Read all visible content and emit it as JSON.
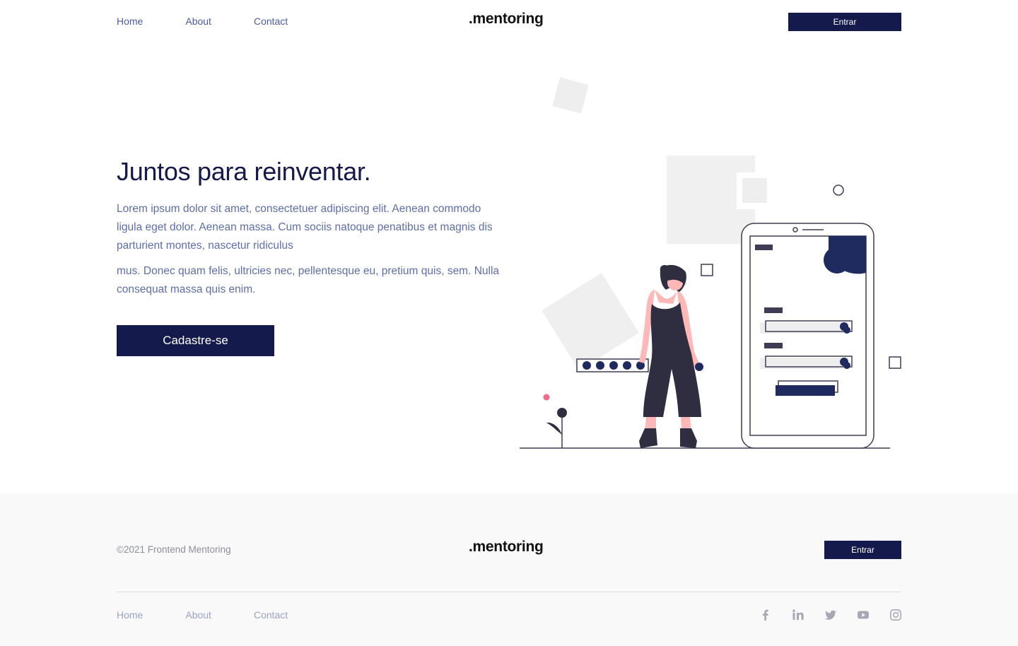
{
  "header": {
    "nav": [
      "Home",
      "About",
      "Contact"
    ],
    "logo": ".mentoring",
    "login_button": "Entrar"
  },
  "hero": {
    "title": "Juntos para reinventar.",
    "paragraph1": "Lorem ipsum dolor sit amet, consectetuer adipiscing elit. Aenean commodo ligula eget dolor. Aenean massa. Cum sociis natoque penatibus et magnis dis parturient montes, nascetur ridiculus",
    "paragraph2": "mus. Donec quam felis, ultricies nec, pellentesque eu, pretium quis, sem. Nulla consequat massa quis enim.",
    "cta_button": "Cadastre-se"
  },
  "footer": {
    "copyright": "©2021 Frontend Mentoring",
    "logo": ".mentoring",
    "login_button": "Entrar",
    "nav": [
      "Home",
      "About",
      "Contact"
    ],
    "social_icons": [
      "facebook-icon",
      "linkedin-icon",
      "twitter-icon",
      "youtube-icon",
      "instagram-icon"
    ]
  },
  "colors": {
    "primary": "#141a4b",
    "text_muted": "#5e6ea8",
    "footer_bg": "#f9f9f9",
    "accent_pink": "#f16a8a",
    "figure_dark": "#2f2e41"
  }
}
